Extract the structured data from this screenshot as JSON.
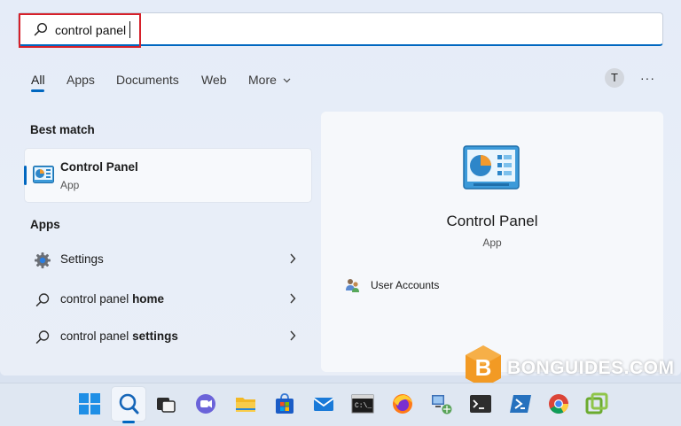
{
  "search": {
    "value": "control panel",
    "icon": "search-icon"
  },
  "tabs": [
    {
      "label": "All",
      "active": true
    },
    {
      "label": "Apps"
    },
    {
      "label": "Documents"
    },
    {
      "label": "Web"
    },
    {
      "label": "More"
    }
  ],
  "account": {
    "initial": "T"
  },
  "more_options": "···",
  "best_match": {
    "section_label": "Best match",
    "title": "Control Panel",
    "subtitle": "App"
  },
  "apps": {
    "section_label": "Apps",
    "items": [
      {
        "label": "Settings",
        "bold_suffix": ""
      },
      {
        "label": "control panel ",
        "bold_suffix": "home"
      },
      {
        "label": "control panel ",
        "bold_suffix": "settings"
      }
    ]
  },
  "preview": {
    "title": "Control Panel",
    "subtitle": "App",
    "actions": [
      {
        "label": "User Accounts"
      }
    ]
  },
  "watermark": {
    "text": "BONGUIDES.COM",
    "letter": "B"
  },
  "colors": {
    "accent": "#0067c0",
    "highlight_box": "#d6202a"
  },
  "taskbar": {
    "icons": [
      "windows-start-icon",
      "search-icon",
      "task-view-icon",
      "chat-icon",
      "file-explorer-icon",
      "microsoft-store-icon",
      "mail-icon",
      "command-prompt-icon",
      "firefox-icon",
      "network-icon",
      "terminal-icon",
      "powershell-icon",
      "chrome-icon",
      "vmware-icon"
    ]
  }
}
